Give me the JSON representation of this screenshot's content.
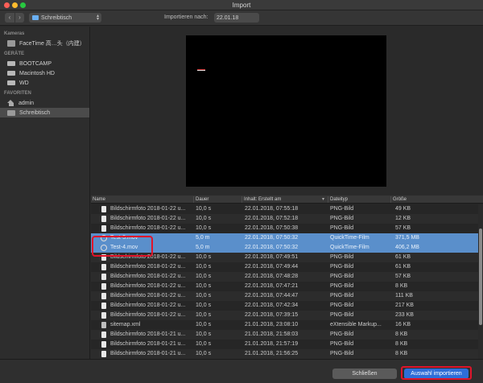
{
  "window": {
    "title": "Import"
  },
  "toolbar": {
    "location": "Schreibtisch",
    "import_label": "Importieren nach:",
    "import_target": "22.01.18"
  },
  "sidebar": {
    "sections": [
      {
        "title": "Kameras",
        "items": [
          {
            "label": "FaceTime 高…头（内建）",
            "icon": "camera-icon"
          }
        ]
      },
      {
        "title": "GERÄTE",
        "items": [
          {
            "label": "BOOTCAMP",
            "icon": "drive-icon"
          },
          {
            "label": "Macintosh HD",
            "icon": "drive-icon"
          },
          {
            "label": "WD",
            "icon": "drive-icon"
          }
        ]
      },
      {
        "title": "FAVORITEN",
        "items": [
          {
            "label": "admin",
            "icon": "home-icon"
          },
          {
            "label": "Schreibtisch",
            "icon": "desktop-icon",
            "selected": true
          }
        ]
      }
    ]
  },
  "table": {
    "headers": {
      "name": "Name",
      "duration": "Dauer",
      "date": "Inhalt: Erstellt am",
      "type": "Dateityp",
      "size": "Größe"
    },
    "rows": [
      {
        "name": "Bildschirmfoto 2018-01-22 u...",
        "duration": "10,0 s",
        "date": "22.01.2018, 07:55:18",
        "type": "PNG-Bild",
        "size": "49 KB",
        "icon": "image"
      },
      {
        "name": "Bildschirmfoto 2018-01-22 u...",
        "duration": "10,0 s",
        "date": "22.01.2018, 07:52:18",
        "type": "PNG-Bild",
        "size": "12 KB",
        "icon": "image"
      },
      {
        "name": "Bildschirmfoto 2018-01-22 u...",
        "duration": "10,0 s",
        "date": "22.01.2018, 07:50:38",
        "type": "PNG-Bild",
        "size": "57 KB",
        "icon": "image"
      },
      {
        "name": "Test-3.mov",
        "duration": "5,0 m",
        "date": "22.01.2018, 07:50:32",
        "type": "QuickTime-Film",
        "size": "371,5 MB",
        "icon": "movie",
        "selected": true
      },
      {
        "name": "Test-4.mov",
        "duration": "5,0 m",
        "date": "22.01.2018, 07:50:32",
        "type": "QuickTime-Film",
        "size": "406,2 MB",
        "icon": "movie",
        "selected": true
      },
      {
        "name": "Bildschirmfoto 2018-01-22 u...",
        "duration": "10,0 s",
        "date": "22.01.2018, 07:49:51",
        "type": "PNG-Bild",
        "size": "61 KB",
        "icon": "image"
      },
      {
        "name": "Bildschirmfoto 2018-01-22 u...",
        "duration": "10,0 s",
        "date": "22.01.2018, 07:49:44",
        "type": "PNG-Bild",
        "size": "61 KB",
        "icon": "image"
      },
      {
        "name": "Bildschirmfoto 2018-01-22 u...",
        "duration": "10,0 s",
        "date": "22.01.2018, 07:48:28",
        "type": "PNG-Bild",
        "size": "57 KB",
        "icon": "image"
      },
      {
        "name": "Bildschirmfoto 2018-01-22 u...",
        "duration": "10,0 s",
        "date": "22.01.2018, 07:47:21",
        "type": "PNG-Bild",
        "size": "8 KB",
        "icon": "image"
      },
      {
        "name": "Bildschirmfoto 2018-01-22 u...",
        "duration": "10,0 s",
        "date": "22.01.2018, 07:44:47",
        "type": "PNG-Bild",
        "size": "111 KB",
        "icon": "image"
      },
      {
        "name": "Bildschirmfoto 2018-01-22 u...",
        "duration": "10,0 s",
        "date": "22.01.2018, 07:42:34",
        "type": "PNG-Bild",
        "size": "217 KB",
        "icon": "image"
      },
      {
        "name": "Bildschirmfoto 2018-01-22 u...",
        "duration": "10,0 s",
        "date": "22.01.2018, 07:39:15",
        "type": "PNG-Bild",
        "size": "233 KB",
        "icon": "image"
      },
      {
        "name": "sitemap.xml",
        "duration": "10,0 s",
        "date": "21.01.2018, 23:08:10",
        "type": "eXtensible Markup...",
        "size": "16 KB",
        "icon": "xml"
      },
      {
        "name": "Bildschirmfoto 2018-01-21 u...",
        "duration": "10,0 s",
        "date": "21.01.2018, 21:58:03",
        "type": "PNG-Bild",
        "size": "8 KB",
        "icon": "image"
      },
      {
        "name": "Bildschirmfoto 2018-01-21 u...",
        "duration": "10,0 s",
        "date": "21.01.2018, 21:57:19",
        "type": "PNG-Bild",
        "size": "8 KB",
        "icon": "image"
      },
      {
        "name": "Bildschirmfoto 2018-01-21 u...",
        "duration": "10,0 s",
        "date": "21.01.2018, 21:56:25",
        "type": "PNG-Bild",
        "size": "8 KB",
        "icon": "image"
      }
    ]
  },
  "footer": {
    "close_label": "Schließen",
    "import_label": "Auswahl importieren"
  },
  "colors": {
    "accent": "#2e6ed8",
    "selection": "#5a8fcb",
    "highlight": "#e0142a"
  }
}
